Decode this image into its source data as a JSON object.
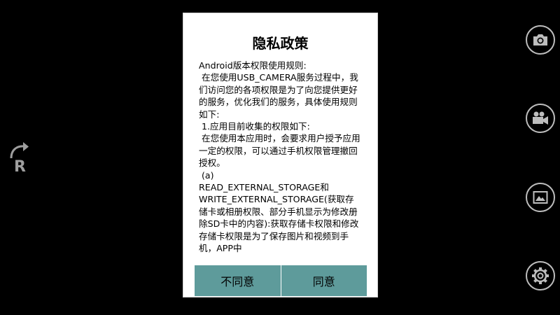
{
  "dialog": {
    "title": "隐私政策",
    "body": "Android版本权限使用规则:\n 在您使用USB_CAMERA服务过程中，我们访问您的各项权限是为了向您提供更好的服务，优化我们的服务，具体使用规则如下:\n 1.应用目前收集的权限如下:\n 在您使用本应用时，会要求用户授予应用一定的权限，可以通过手机权限管理撤回授权。\n (a)\nREAD_EXTERNAL_STORAGE和\nWRITE_EXTERNAL_STORAGE(获取存储卡或相册权限、部分手机显示为修改册除SD卡中的内容):获取存储卡权限和修改存储卡权限是为了保存图片和视频到手机，APP中",
    "disagree_label": "不同意",
    "agree_label": "同意"
  },
  "controls": {
    "rotate_letter": "R"
  },
  "colors": {
    "background": "#000000",
    "dialog_background": "#ffffff",
    "button_background": "#5e9b9b",
    "icon_color": "#bdbdbd"
  },
  "icons": {
    "rotate": "rotate-icon",
    "photo": "camera-icon",
    "video": "video-camera-icon",
    "gallery": "image-icon",
    "settings": "gear-icon"
  }
}
